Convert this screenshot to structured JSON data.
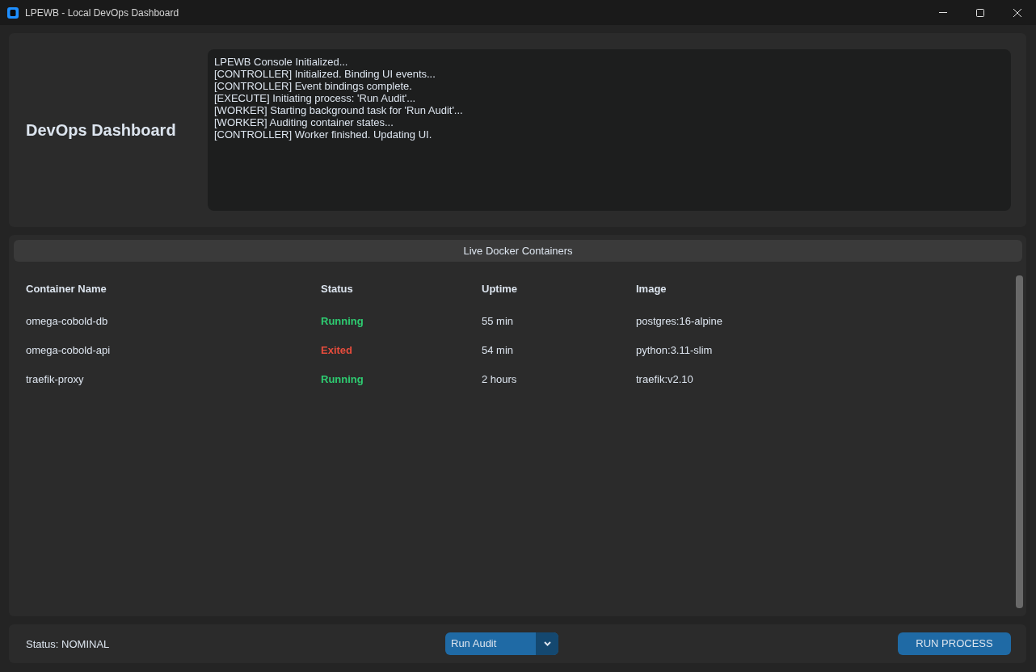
{
  "window": {
    "title": "LPEWB - Local DevOps Dashboard"
  },
  "header": {
    "title": "DevOps Dashboard"
  },
  "console": {
    "lines": [
      "LPEWB Console Initialized...",
      "[CONTROLLER] Initialized. Binding UI events...",
      "[CONTROLLER] Event bindings complete.",
      "[EXECUTE] Initiating process: 'Run Audit'...",
      "[WORKER] Starting background task for 'Run Audit'...",
      "[WORKER] Auditing container states...",
      "[CONTROLLER] Worker finished. Updating UI."
    ]
  },
  "containers_panel": {
    "title": "Live Docker Containers",
    "table": {
      "columns": [
        "Container Name",
        "Status",
        "Uptime",
        "Image"
      ],
      "rows": [
        {
          "name": "omega-cobold-db",
          "status": "Running",
          "color": "#2ecc71",
          "uptime": "55 min",
          "image": "postgres:16-alpine"
        },
        {
          "name": "omega-cobold-api",
          "status": "Exited",
          "color": "#e74c3c",
          "uptime": "54 min",
          "image": "python:3.11-slim"
        },
        {
          "name": "traefik-proxy",
          "status": "Running",
          "color": "#2ecc71",
          "uptime": "2 hours",
          "image": "traefik:v2.10"
        }
      ]
    }
  },
  "status_bar": {
    "status": "Status: NOMINAL",
    "process_select": {
      "value": "Run Audit"
    },
    "run_button": {
      "label": "RUN PROCESS"
    }
  }
}
